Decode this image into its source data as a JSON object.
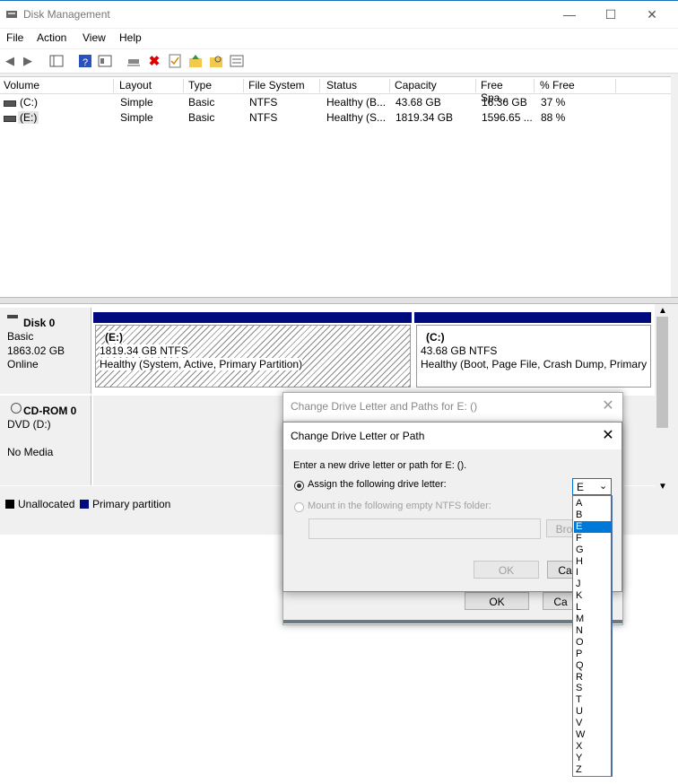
{
  "window": {
    "title": "Disk Management",
    "min": "—",
    "max": "☐",
    "close": "✕"
  },
  "menu": [
    "File",
    "Action",
    "View",
    "Help"
  ],
  "columns": [
    "Volume",
    "Layout",
    "Type",
    "File System",
    "Status",
    "Capacity",
    "Free Spa...",
    "% Free"
  ],
  "volumes": [
    [
      "(C:)",
      "Simple",
      "Basic",
      "NTFS",
      "Healthy (B...",
      "43.68 GB",
      "16.36 GB",
      "37 %"
    ],
    [
      "(E:)",
      "Simple",
      "Basic",
      "NTFS",
      "Healthy (S...",
      "1819.34 GB",
      "1596.65 ...",
      "88 %"
    ]
  ],
  "disk0": {
    "name": "Disk 0",
    "type": "Basic",
    "size": "1863.02 GB",
    "state": "Online",
    "partitions": [
      {
        "name": "(E:)",
        "size": "1819.34 GB NTFS",
        "status": "Healthy (System, Active, Primary Partition)"
      },
      {
        "name": "(C:)",
        "size": "43.68 GB NTFS",
        "status": "Healthy (Boot, Page File, Crash Dump, Primary P"
      }
    ]
  },
  "cdrom0": {
    "name": "CD-ROM 0",
    "type": "DVD (D:)",
    "state": "No Media"
  },
  "legend": {
    "unallocated": "Unallocated",
    "primary": "Primary partition",
    "unallocated_color": "#000000",
    "primary_color": "#000a7f"
  },
  "dialog_outer": {
    "title": "Change Drive Letter and Paths for E: ()",
    "ok": "OK",
    "cancel": "Ca"
  },
  "dialog_inner": {
    "title": "Change Drive Letter or Path",
    "prompt": "Enter a new drive letter or path for E: ().",
    "assign_label": "Assign the following drive letter:",
    "mount_label": "Mount in the following empty NTFS folder:",
    "folder_value": "",
    "browse": "Bro",
    "ok": "OK",
    "cancel": "Ca",
    "selected_letter": "E"
  },
  "letters": [
    "A",
    "B",
    "E",
    "F",
    "G",
    "H",
    "I",
    "J",
    "K",
    "L",
    "M",
    "N",
    "O",
    "P",
    "Q",
    "R",
    "S",
    "T",
    "U",
    "V",
    "W",
    "X",
    "Y",
    "Z"
  ]
}
